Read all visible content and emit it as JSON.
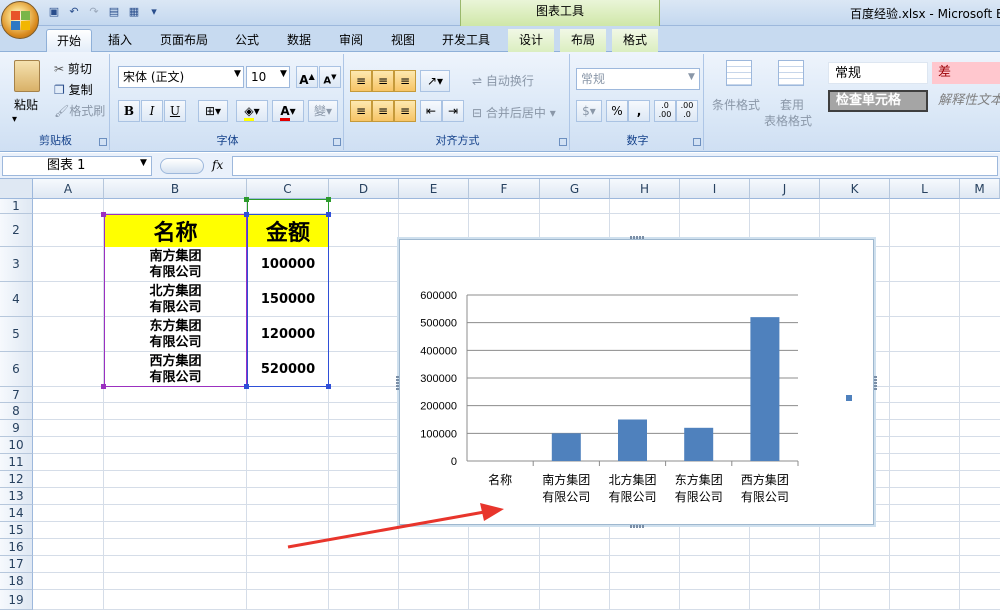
{
  "window": {
    "context_tab": "图表工具",
    "title": "百度经验.xlsx - Microsoft E"
  },
  "tabs": [
    {
      "label": "开始",
      "active": true
    },
    {
      "label": "插入"
    },
    {
      "label": "页面布局"
    },
    {
      "label": "公式"
    },
    {
      "label": "数据"
    },
    {
      "label": "审阅"
    },
    {
      "label": "视图"
    },
    {
      "label": "开发工具"
    },
    {
      "label": "设计",
      "chart_tools": true
    },
    {
      "label": "布局",
      "chart_tools": true
    },
    {
      "label": "格式",
      "chart_tools": true
    }
  ],
  "ribbon": {
    "clipboard": {
      "label": "剪贴板",
      "paste": "粘贴",
      "cut": "剪切",
      "copy": "复制",
      "format_painter": "格式刷"
    },
    "font": {
      "label": "字体",
      "font_name": "宋体 (正文)",
      "font_size": "10",
      "bold": "B",
      "italic": "I",
      "underline": "U",
      "font_color_glyph": "A"
    },
    "alignment": {
      "label": "对齐方式",
      "wrap_text": "自动换行",
      "merge_center": "合并后居中"
    },
    "number": {
      "label": "数字",
      "format": "常规",
      "percent": "%",
      "comma": ",",
      "inc_decimal": ".0 .00",
      "dec_decimal": ".00 .0"
    },
    "styles": {
      "conditional_format": "条件格式",
      "table_format_1": "套用",
      "table_format_2": "表格格式",
      "style_normal": "常规",
      "style_bad": "差",
      "style_check_cell": "检查单元格",
      "style_explanatory": "解释性文本"
    }
  },
  "formula_bar": {
    "name_box": "图表 1",
    "fx": "fx",
    "content": ""
  },
  "columns": [
    "A",
    "B",
    "C",
    "D",
    "E",
    "F",
    "G",
    "H",
    "I",
    "J",
    "K",
    "L",
    "M"
  ],
  "rows": [
    "1",
    "2",
    "3",
    "4",
    "5",
    "6",
    "7",
    "8",
    "9",
    "10",
    "11",
    "12",
    "13",
    "14",
    "15",
    "16",
    "17",
    "18",
    "19"
  ],
  "table": {
    "header_name": "名称",
    "header_amount": "金额",
    "rows": [
      {
        "name_l1": "南方集团",
        "name_l2": "有限公司",
        "amount": "100000"
      },
      {
        "name_l1": "北方集团",
        "name_l2": "有限公司",
        "amount": "150000"
      },
      {
        "name_l1": "东方集团",
        "name_l2": "有限公司",
        "amount": "120000"
      },
      {
        "name_l1": "西方集团",
        "name_l2": "有限公司",
        "amount": "520000"
      }
    ]
  },
  "chart_data": {
    "type": "bar",
    "categories": [
      "名称",
      "南方集团\n有限公司",
      "北方集团\n有限公司",
      "东方集团\n有限公司",
      "西方集团\n有限公司"
    ],
    "values": [
      0,
      100000,
      150000,
      120000,
      520000
    ],
    "yticks": [
      "0",
      "100000",
      "200000",
      "300000",
      "400000",
      "500000",
      "600000"
    ],
    "ylim": [
      0,
      600000
    ],
    "grid": true,
    "legend": "right",
    "bar_color": "#4f81bd"
  }
}
